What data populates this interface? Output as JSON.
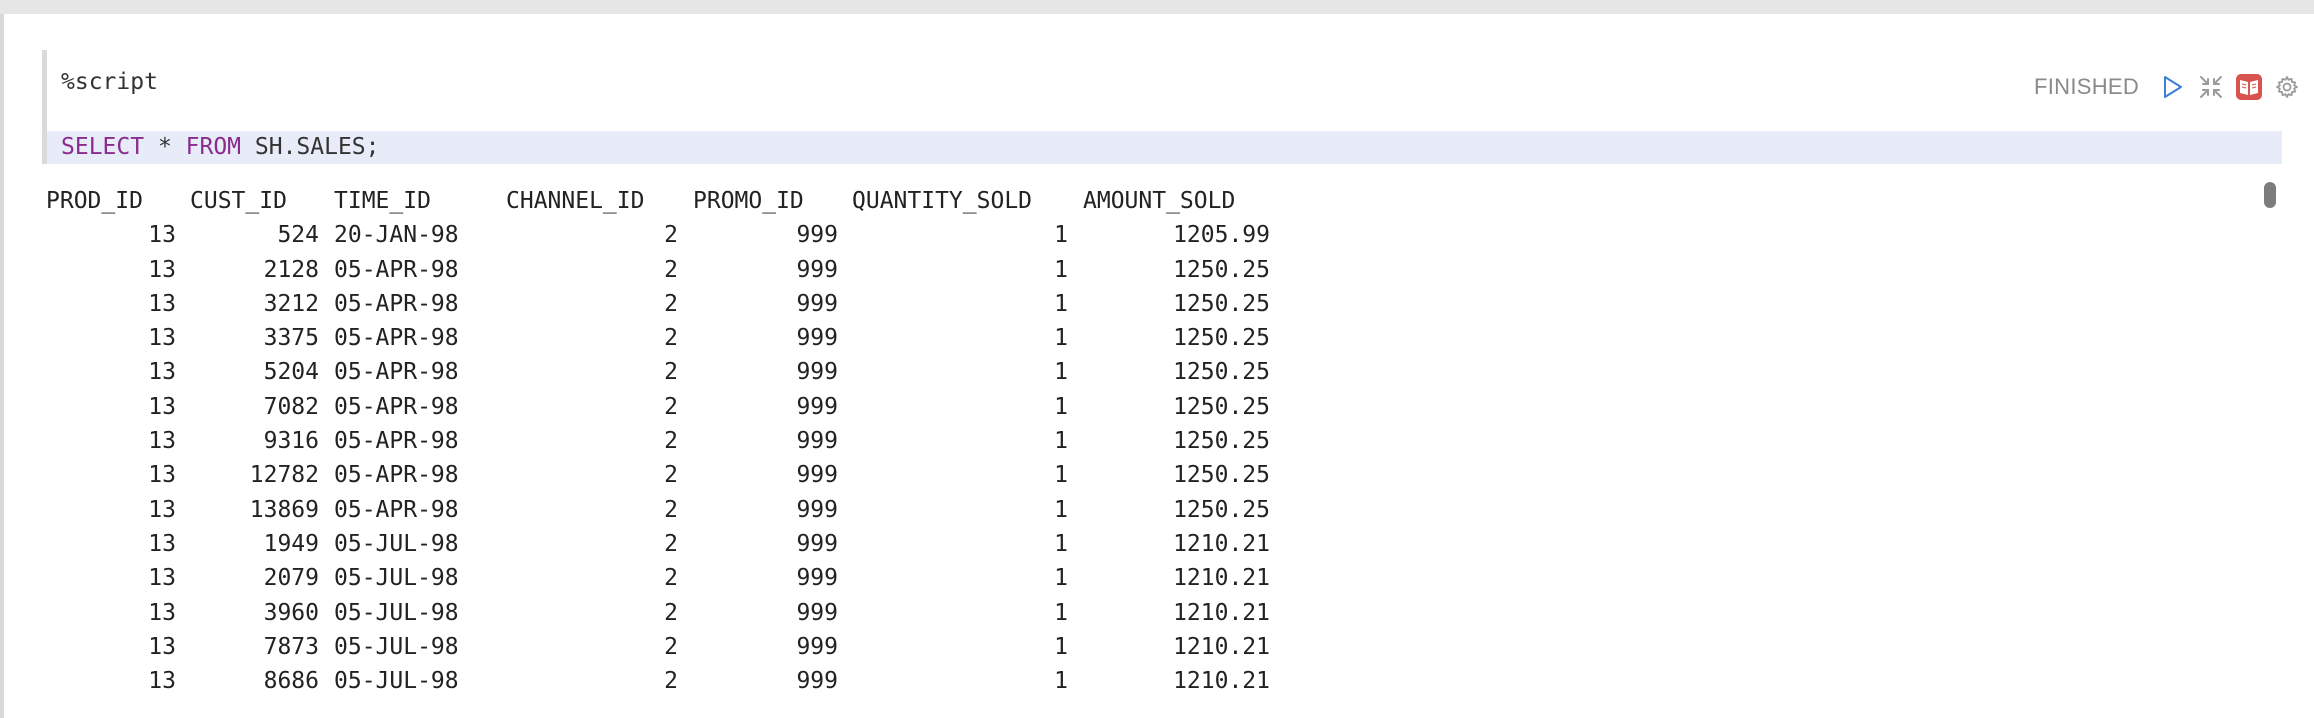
{
  "editor": {
    "line1": "%script",
    "line2_kw1": "SELECT",
    "line2_mid": " * ",
    "line2_kw2": "FROM",
    "line2_rest": " SH.SALES;"
  },
  "status": "FINISHED",
  "icons": [
    "run-icon",
    "collapse-icon",
    "book-icon",
    "settings-icon"
  ],
  "colors": {
    "keyword": "#8a2c8f",
    "run_icon": "#3b7fd6",
    "book_icon": "#d9534f",
    "editor_highlight": "#e8ebf8"
  },
  "table": {
    "headers": [
      "PROD_ID",
      "CUST_ID",
      "TIME_ID",
      "CHANNEL_ID",
      "PROMO_ID",
      "QUANTITY_SOLD",
      "AMOUNT_SOLD"
    ],
    "rows": [
      [
        "13",
        "524",
        "20-JAN-98",
        "2",
        "999",
        "1",
        "1205.99"
      ],
      [
        "13",
        "2128",
        "05-APR-98",
        "2",
        "999",
        "1",
        "1250.25"
      ],
      [
        "13",
        "3212",
        "05-APR-98",
        "2",
        "999",
        "1",
        "1250.25"
      ],
      [
        "13",
        "3375",
        "05-APR-98",
        "2",
        "999",
        "1",
        "1250.25"
      ],
      [
        "13",
        "5204",
        "05-APR-98",
        "2",
        "999",
        "1",
        "1250.25"
      ],
      [
        "13",
        "7082",
        "05-APR-98",
        "2",
        "999",
        "1",
        "1250.25"
      ],
      [
        "13",
        "9316",
        "05-APR-98",
        "2",
        "999",
        "1",
        "1250.25"
      ],
      [
        "13",
        "12782",
        "05-APR-98",
        "2",
        "999",
        "1",
        "1250.25"
      ],
      [
        "13",
        "13869",
        "05-APR-98",
        "2",
        "999",
        "1",
        "1250.25"
      ],
      [
        "13",
        "1949",
        "05-JUL-98",
        "2",
        "999",
        "1",
        "1210.21"
      ],
      [
        "13",
        "2079",
        "05-JUL-98",
        "2",
        "999",
        "1",
        "1210.21"
      ],
      [
        "13",
        "3960",
        "05-JUL-98",
        "2",
        "999",
        "1",
        "1210.21"
      ],
      [
        "13",
        "7873",
        "05-JUL-98",
        "2",
        "999",
        "1",
        "1210.21"
      ],
      [
        "13",
        "8686",
        "05-JUL-98",
        "2",
        "999",
        "1",
        "1210.21"
      ]
    ]
  }
}
